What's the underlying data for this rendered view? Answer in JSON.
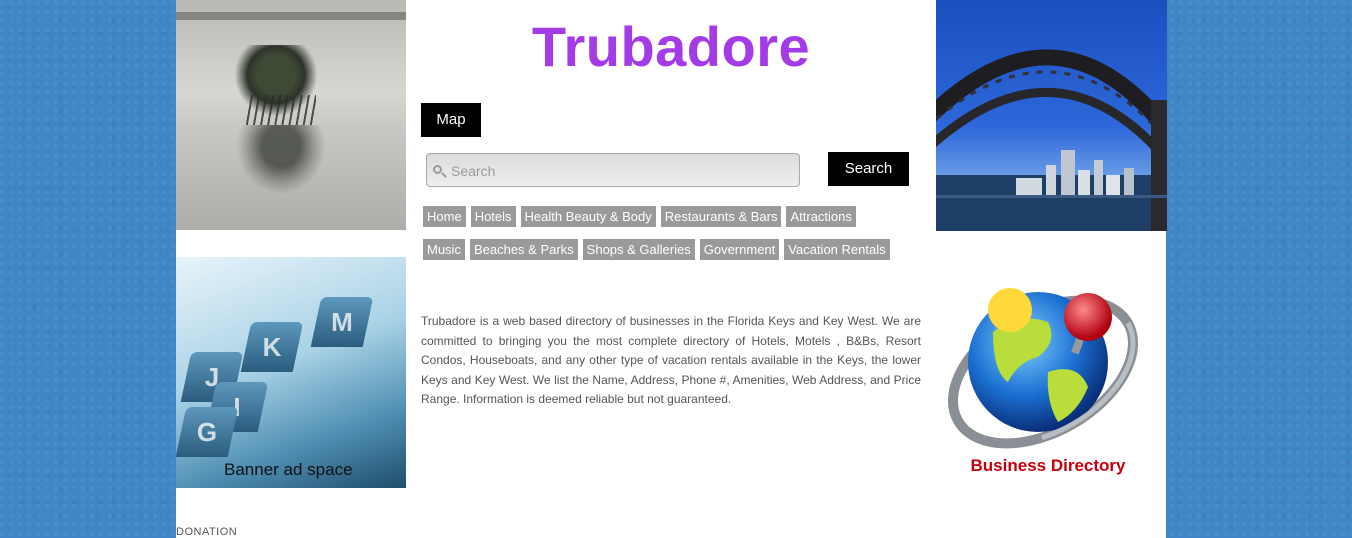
{
  "site": {
    "title": "Trubadore"
  },
  "header": {
    "map_label": "Map"
  },
  "search": {
    "placeholder": "Search",
    "value": "",
    "button_label": "Search"
  },
  "nav": {
    "row1": [
      "Home",
      "Hotels",
      "Health Beauty & Body",
      "Restaurants & Bars",
      "Attractions"
    ],
    "row2": [
      "Music",
      "Beaches & Parks",
      "Shops & Galleries",
      "Government",
      "Vacation Rentals"
    ]
  },
  "intro": {
    "text": "Trubadore is a web based directory of businesses in the Florida Keys and Key West. We are committed to bringing you the most complete directory of Hotels, Motels , B&Bs, Resort Condos, Houseboats, and any other type of vacation rentals available in the Keys, the lower Keys and Key West. We list the Name, Address, Phone #, Amenities, Web Address, and Price Range. Information is deemed reliable but not guaranteed."
  },
  "banner": {
    "text": "Banner ad space",
    "tab_letters": [
      "J",
      "K",
      "M",
      "I",
      "G"
    ]
  },
  "business_directory": {
    "label": "Business Directory"
  },
  "footer": {
    "donation_label": "DONATION"
  },
  "colors": {
    "brand": "#a33be6",
    "nav_bg": "#9a9a9a",
    "button_bg": "#000000",
    "page_bg": "#3f86c6"
  },
  "icons": [
    "search-icon",
    "globe-pin-icon"
  ]
}
